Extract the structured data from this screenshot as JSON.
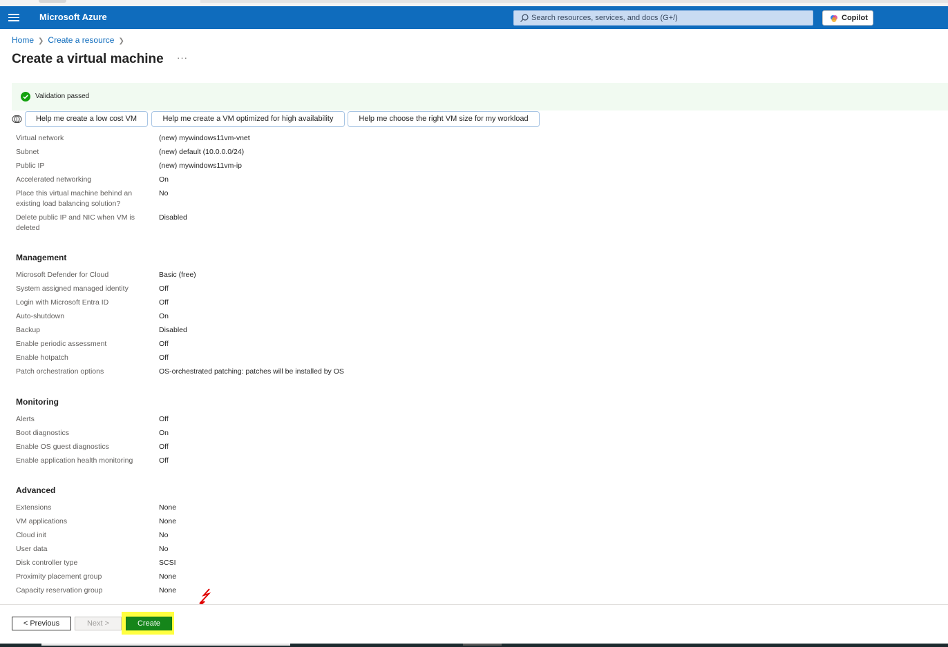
{
  "app": {
    "brand": "Microsoft Azure"
  },
  "search": {
    "placeholder": "Search resources, services, and docs (G+/)"
  },
  "copilot": {
    "label": "Copilot"
  },
  "breadcrumb": {
    "items": [
      "Home",
      "Create a resource"
    ]
  },
  "page": {
    "title": "Create a virtual machine",
    "more": "···"
  },
  "validation": {
    "text": "Validation passed",
    "color": "#107c10"
  },
  "helpers": {
    "items": [
      "Help me create a low cost VM",
      "Help me create a VM optimized for high availability",
      "Help me choose the right VM size for my workload"
    ]
  },
  "networking": {
    "rows": [
      {
        "label": "Virtual network",
        "value": "(new) mywindows11vm-vnet"
      },
      {
        "label": "Subnet",
        "value": "(new) default (10.0.0.0/24)"
      },
      {
        "label": "Public IP",
        "value": "(new) mywindows11vm-ip"
      },
      {
        "label": "Accelerated networking",
        "value": "On"
      },
      {
        "label": "Place this virtual machine behind an existing load balancing solution?",
        "value": "No"
      },
      {
        "label": "Delete public IP and NIC when VM is deleted",
        "value": "Disabled"
      }
    ]
  },
  "management": {
    "title": "Management",
    "rows": [
      {
        "label": "Microsoft Defender for Cloud",
        "value": "Basic (free)"
      },
      {
        "label": "System assigned managed identity",
        "value": "Off"
      },
      {
        "label": "Login with Microsoft Entra ID",
        "value": "Off"
      },
      {
        "label": "Auto-shutdown",
        "value": "On"
      },
      {
        "label": "Backup",
        "value": "Disabled"
      },
      {
        "label": "Enable periodic assessment",
        "value": "Off"
      },
      {
        "label": "Enable hotpatch",
        "value": "Off"
      },
      {
        "label": "Patch orchestration options",
        "value": "OS-orchestrated patching: patches will be installed by OS"
      }
    ]
  },
  "monitoring": {
    "title": "Monitoring",
    "rows": [
      {
        "label": "Alerts",
        "value": "Off"
      },
      {
        "label": "Boot diagnostics",
        "value": "On"
      },
      {
        "label": "Enable OS guest diagnostics",
        "value": "Off"
      },
      {
        "label": "Enable application health monitoring",
        "value": "Off"
      }
    ]
  },
  "advanced": {
    "title": "Advanced",
    "rows": [
      {
        "label": "Extensions",
        "value": "None"
      },
      {
        "label": "VM applications",
        "value": "None"
      },
      {
        "label": "Cloud init",
        "value": "No"
      },
      {
        "label": "User data",
        "value": "No"
      },
      {
        "label": "Disk controller type",
        "value": "SCSI"
      },
      {
        "label": "Proximity placement group",
        "value": "None"
      },
      {
        "label": "Capacity reservation group",
        "value": "None"
      }
    ]
  },
  "footer": {
    "previous": "< Previous",
    "next": "Next >",
    "create": "Create"
  },
  "colors": {
    "topbar": "#0f6cbd",
    "create": "#15851a",
    "highlight": "#ffff00",
    "annotation": "#e00000"
  }
}
